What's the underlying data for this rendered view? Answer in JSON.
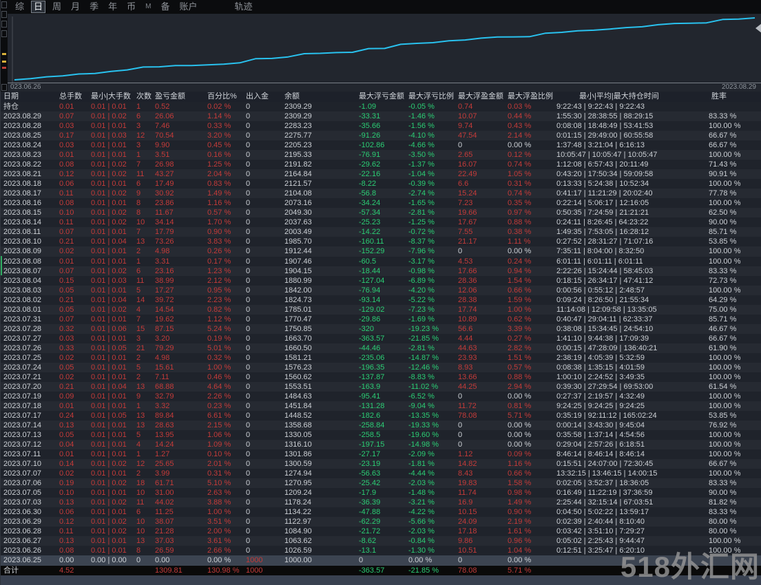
{
  "toolbar": {
    "items": [
      "综",
      "日",
      "周",
      "月",
      "季",
      "年",
      "币",
      "M",
      "备",
      "账户"
    ],
    "active": "日",
    "trail": "轨迹"
  },
  "chart": {
    "start_label": "023.06.26",
    "end_label": "2023.08.29",
    "line_color": "#29c2ef"
  },
  "chart_data": {
    "type": "line",
    "title": "账户余额轨迹",
    "x_start": "2023.06.26",
    "x_end": "2023.08.29",
    "ylim": [
      1000,
      2309.29
    ],
    "values": [
      1000.0,
      1026.59,
      1063.62,
      1084.9,
      1122.97,
      1134.22,
      1178.24,
      1209.24,
      1270.95,
      1274.94,
      1300.59,
      1301.86,
      1316.1,
      1330.05,
      1358.68,
      1448.52,
      1451.84,
      1484.63,
      1553.51,
      1560.62,
      1576.23,
      1581.21,
      1660.5,
      1663.7,
      1750.85,
      1770.47,
      1785.01,
      1824.73,
      1842.0,
      1880.99,
      1904.15,
      1907.46,
      1912.44,
      1985.7,
      2003.49,
      2037.63,
      2049.3,
      2073.16,
      2104.08,
      2121.57,
      2164.84,
      2191.82,
      2195.33,
      2205.23,
      2275.77,
      2283.23,
      2309.29
    ]
  },
  "table": {
    "headers": [
      "日期",
      "总手数",
      "最小|大手数",
      "次数",
      "盈亏金额",
      "百分比%",
      "出入金",
      "余额",
      "最大浮亏金额",
      "最大浮亏比例",
      "最大浮盈金额",
      "最大浮盈比例",
      "最小|平均|最大持仓时间",
      "胜率"
    ],
    "selected_index": 47,
    "total_label": "合计",
    "rows": [
      [
        "持仓",
        "0.01",
        "0.01 | 0.01",
        "1",
        "0.52",
        "0.02 %",
        "0",
        "2309.29",
        "-1.09",
        "-0.05 %",
        "0.74",
        "0.03 %",
        "9:22:43 | 9:22:43 | 9:22:43",
        ""
      ],
      [
        "2023.08.29",
        "0.07",
        "0.01 | 0.02",
        "6",
        "26.06",
        "1.14 %",
        "0",
        "2309.29",
        "-33.31",
        "-1.46 %",
        "10.07",
        "0.44 %",
        "1:55:30 | 28:38:55 | 88:29:15",
        "83.33 %"
      ],
      [
        "2023.08.28",
        "0.03",
        "0.01 | 0.01",
        "3",
        "7.46",
        "0.33 %",
        "0",
        "2283.23",
        "-35.66",
        "-1.56 %",
        "9.74",
        "0.43 %",
        "0:08:08 | 18:48:49 | 53:41:53",
        "100.00 %"
      ],
      [
        "2023.08.25",
        "0.17",
        "0.01 | 0.03",
        "12",
        "70.54",
        "3.20 %",
        "0",
        "2275.77",
        "-91.26",
        "-4.10 %",
        "47.54",
        "2.14 %",
        "0:01:15 | 29:49:00 | 60:55:58",
        "66.67 %"
      ],
      [
        "2023.08.24",
        "0.03",
        "0.01 | 0.01",
        "3",
        "9.90",
        "0.45 %",
        "0",
        "2205.23",
        "-102.86",
        "-4.66 %",
        "0",
        "0.00 %",
        "1:37:48 | 3:21:04 | 6:16:13",
        "66.67 %"
      ],
      [
        "2023.08.23",
        "0.01",
        "0.01 | 0.01",
        "1",
        "3.51",
        "0.16 %",
        "0",
        "2195.33",
        "-76.91",
        "-3.50 %",
        "2.65",
        "0.12 %",
        "10:05:47 | 10:05:47 | 10:05:47",
        "100.00 %"
      ],
      [
        "2023.08.22",
        "0.08",
        "0.01 | 0.02",
        "7",
        "26.98",
        "1.25 %",
        "0",
        "2191.82",
        "-29.62",
        "-1.37 %",
        "16.07",
        "0.74 %",
        "1:12:08 | 6:57:43 | 20:11:49",
        "71.43 %"
      ],
      [
        "2023.08.21",
        "0.12",
        "0.01 | 0.02",
        "11",
        "43.27",
        "2.04 %",
        "0",
        "2164.84",
        "-22.16",
        "-1.04 %",
        "22.49",
        "1.05 %",
        "0:43:20 | 17:50:34 | 59:09:58",
        "90.91 %"
      ],
      [
        "2023.08.18",
        "0.06",
        "0.01 | 0.01",
        "6",
        "17.49",
        "0.83 %",
        "0",
        "2121.57",
        "-8.22",
        "-0.39 %",
        "6.6",
        "0.31 %",
        "0:13:33 | 5:24:38 | 10:52:34",
        "100.00 %"
      ],
      [
        "2023.08.17",
        "0.11",
        "0.01 | 0.02",
        "9",
        "30.92",
        "1.49 %",
        "0",
        "2104.08",
        "-56.8",
        "-2.74 %",
        "15.24",
        "0.74 %",
        "0:41:17 | 11:21:29 | 20:02:40",
        "77.78 %"
      ],
      [
        "2023.08.16",
        "0.08",
        "0.01 | 0.01",
        "8",
        "23.86",
        "1.16 %",
        "0",
        "2073.16",
        "-34.24",
        "-1.65 %",
        "7.23",
        "0.35 %",
        "0:22:14 | 5:06:17 | 12:16:05",
        "100.00 %"
      ],
      [
        "2023.08.15",
        "0.10",
        "0.01 | 0.02",
        "8",
        "11.67",
        "0.57 %",
        "0",
        "2049.30",
        "-57.34",
        "-2.81 %",
        "19.66",
        "0.97 %",
        "0:50:35 | 7:24:59 | 21:21:21",
        "62.50 %"
      ],
      [
        "2023.08.14",
        "0.11",
        "0.01 | 0.02",
        "10",
        "34.14",
        "1.70 %",
        "0",
        "2037.63",
        "-25.23",
        "-1.25 %",
        "17.67",
        "0.88 %",
        "0:24:11 | 8:26:45 | 64:23:22",
        "90.00 %"
      ],
      [
        "2023.08.11",
        "0.07",
        "0.01 | 0.01",
        "7",
        "17.79",
        "0.90 %",
        "0",
        "2003.49",
        "-14.22",
        "-0.72 %",
        "7.55",
        "0.38 %",
        "1:49:35 | 7:53:05 | 16:28:12",
        "85.71 %"
      ],
      [
        "2023.08.10",
        "0.21",
        "0.01 | 0.04",
        "13",
        "73.26",
        "3.83 %",
        "0",
        "1985.70",
        "-160.11",
        "-8.37 %",
        "21.17",
        "1.11 %",
        "0:27:52 | 28:31:27 | 71:07:16",
        "53.85 %"
      ],
      [
        "2023.08.09",
        "0.02",
        "0.01 | 0.01",
        "2",
        "4.98",
        "0.26 %",
        "0",
        "1912.44",
        "-152.29",
        "-7.96 %",
        "0",
        "0.00 %",
        "7:35:11 | 8:04:00 | 8:32:50",
        "100.00 %"
      ],
      [
        "2023.08.08",
        "0.01",
        "0.01 | 0.01",
        "1",
        "3.31",
        "0.17 %",
        "0",
        "1907.46",
        "-60.5",
        "-3.17 %",
        "4.53",
        "0.24 %",
        "6:01:11 | 6:01:11 | 6:01:11",
        "100.00 %"
      ],
      [
        "2023.08.07",
        "0.07",
        "0.01 | 0.02",
        "6",
        "23.16",
        "1.23 %",
        "0",
        "1904.15",
        "-18.44",
        "-0.98 %",
        "17.66",
        "0.94 %",
        "2:22:26 | 15:24:44 | 58:45:03",
        "83.33 %"
      ],
      [
        "2023.08.04",
        "0.15",
        "0.01 | 0.03",
        "11",
        "38.99",
        "2.12 %",
        "0",
        "1880.99",
        "-127.04",
        "-6.89 %",
        "28.36",
        "1.54 %",
        "0:18:15 | 26:34:17 | 47:41:12",
        "72.73 %"
      ],
      [
        "2023.08.03",
        "0.05",
        "0.01 | 0.01",
        "5",
        "17.27",
        "0.95 %",
        "0",
        "1842.00",
        "-76.94",
        "-4.20 %",
        "12.06",
        "0.66 %",
        "0:00:56 | 0:55:12 | 2:48:57",
        "100.00 %"
      ],
      [
        "2023.08.02",
        "0.21",
        "0.01 | 0.04",
        "14",
        "39.72",
        "2.23 %",
        "0",
        "1824.73",
        "-93.14",
        "-5.22 %",
        "28.38",
        "1.59 %",
        "0:09:24 | 8:26:50 | 21:55:34",
        "64.29 %"
      ],
      [
        "2023.08.01",
        "0.05",
        "0.01 | 0.02",
        "4",
        "14.54",
        "0.82 %",
        "0",
        "1785.01",
        "-129.02",
        "-7.23 %",
        "17.74",
        "1.00 %",
        "11:14:08 | 12:09:58 | 13:35:05",
        "75.00 %"
      ],
      [
        "2023.07.31",
        "0.07",
        "0.01 | 0.01",
        "7",
        "19.62",
        "1.12 %",
        "0",
        "1770.47",
        "-29.86",
        "-1.69 %",
        "10.89",
        "0.62 %",
        "0:40:47 | 29:04:11 | 62:33:37",
        "85.71 %"
      ],
      [
        "2023.07.28",
        "0.32",
        "0.01 | 0.06",
        "15",
        "87.15",
        "5.24 %",
        "0",
        "1750.85",
        "-320",
        "-19.23 %",
        "56.6",
        "3.39 %",
        "0:38:08 | 15:34:45 | 24:54:10",
        "46.67 %"
      ],
      [
        "2023.07.27",
        "0.03",
        "0.01 | 0.01",
        "3",
        "3.20",
        "0.19 %",
        "0",
        "1663.70",
        "-363.57",
        "-21.85 %",
        "4.44",
        "0.27 %",
        "1:41:10 | 9:44:38 | 17:09:39",
        "66.67 %"
      ],
      [
        "2023.07.26",
        "0.33",
        "0.01 | 0.05",
        "21",
        "79.29",
        "5.01 %",
        "0",
        "1660.50",
        "-44.46",
        "-2.81 %",
        "44.63",
        "2.82 %",
        "0:00:15 | 47:28:09 | 136:40:21",
        "61.90 %"
      ],
      [
        "2023.07.25",
        "0.02",
        "0.01 | 0.01",
        "2",
        "4.98",
        "0.32 %",
        "0",
        "1581.21",
        "-235.06",
        "-14.87 %",
        "23.93",
        "1.51 %",
        "2:38:19 | 4:05:39 | 5:32:59",
        "100.00 %"
      ],
      [
        "2023.07.24",
        "0.05",
        "0.01 | 0.01",
        "5",
        "15.61",
        "1.00 %",
        "0",
        "1576.23",
        "-196.35",
        "-12.46 %",
        "8.93",
        "0.57 %",
        "0:08:38 | 1:35:15 | 4:01:59",
        "100.00 %"
      ],
      [
        "2023.07.21",
        "0.02",
        "0.01 | 0.01",
        "2",
        "7.11",
        "0.46 %",
        "0",
        "1560.62",
        "-137.87",
        "-8.83 %",
        "13.66",
        "0.88 %",
        "1:00:10 | 2:24:52 | 3:49:35",
        "100.00 %"
      ],
      [
        "2023.07.20",
        "0.21",
        "0.01 | 0.04",
        "13",
        "68.88",
        "4.64 %",
        "0",
        "1553.51",
        "-163.9",
        "-11.02 %",
        "44.25",
        "2.94 %",
        "0:39:30 | 27:29:54 | 69:53:00",
        "61.54 %"
      ],
      [
        "2023.07.19",
        "0.09",
        "0.01 | 0.01",
        "9",
        "32.79",
        "2.26 %",
        "0",
        "1484.63",
        "-95.41",
        "-6.52 %",
        "0",
        "0.00 %",
        "0:27:37 | 2:19:57 | 4:32:49",
        "100.00 %"
      ],
      [
        "2023.07.18",
        "0.01",
        "0.01 | 0.01",
        "1",
        "3.32",
        "0.23 %",
        "0",
        "1451.84",
        "-131.28",
        "-9.04 %",
        "11.72",
        "0.81 %",
        "9:24:25 | 9:24:25 | 9:24:25",
        "100.00 %"
      ],
      [
        "2023.07.17",
        "0.24",
        "0.01 | 0.05",
        "13",
        "89.84",
        "6.61 %",
        "0",
        "1448.52",
        "-182.6",
        "-13.35 %",
        "78.08",
        "5.71 %",
        "0:35:19 | 92:11:12 | 165:02:24",
        "53.85 %"
      ],
      [
        "2023.07.14",
        "0.13",
        "0.01 | 0.01",
        "13",
        "28.63",
        "2.15 %",
        "0",
        "1358.68",
        "-258.84",
        "-19.33 %",
        "0",
        "0.00 %",
        "0:00:14 | 3:43:30 | 9:45:04",
        "76.92 %"
      ],
      [
        "2023.07.13",
        "0.05",
        "0.01 | 0.01",
        "5",
        "13.95",
        "1.06 %",
        "0",
        "1330.05",
        "-258.5",
        "-19.60 %",
        "0",
        "0.00 %",
        "0:35:58 | 1:37:14 | 4:54:56",
        "100.00 %"
      ],
      [
        "2023.07.12",
        "0.04",
        "0.01 | 0.01",
        "4",
        "14.24",
        "1.09 %",
        "0",
        "1316.10",
        "-197.15",
        "-14.98 %",
        "0",
        "0.00 %",
        "0:29:04 | 2:57:26 | 6:18:51",
        "100.00 %"
      ],
      [
        "2023.07.11",
        "0.01",
        "0.01 | 0.01",
        "1",
        "1.27",
        "0.10 %",
        "0",
        "1301.86",
        "-27.17",
        "-2.09 %",
        "1.12",
        "0.09 %",
        "8:46:14 | 8:46:14 | 8:46:14",
        "100.00 %"
      ],
      [
        "2023.07.10",
        "0.14",
        "0.01 | 0.02",
        "12",
        "25.65",
        "2.01 %",
        "0",
        "1300.59",
        "-23.19",
        "-1.81 %",
        "14.82",
        "1.16 %",
        "0:15:51 | 24:07:00 | 72:30:45",
        "66.67 %"
      ],
      [
        "2023.07.07",
        "0.02",
        "0.01 | 0.01",
        "2",
        "3.99",
        "0.31 %",
        "0",
        "1274.94",
        "-56.63",
        "-4.44 %",
        "8.43",
        "0.66 %",
        "13:32:15 | 13:46:15 | 14:00:15",
        "100.00 %"
      ],
      [
        "2023.07.06",
        "0.19",
        "0.01 | 0.02",
        "18",
        "61.71",
        "5.10 %",
        "0",
        "1270.95",
        "-25.42",
        "-2.03 %",
        "19.83",
        "1.58 %",
        "0:02:05 | 3:52:37 | 18:36:05",
        "83.33 %"
      ],
      [
        "2023.07.05",
        "0.10",
        "0.01 | 0.01",
        "10",
        "31.00",
        "2.63 %",
        "0",
        "1209.24",
        "-17.9",
        "-1.48 %",
        "11.74",
        "0.98 %",
        "0:16:49 | 11:22:19 | 37:36:59",
        "90.00 %"
      ],
      [
        "2023.07.03",
        "0.13",
        "0.01 | 0.02",
        "11",
        "44.02",
        "3.88 %",
        "0",
        "1178.24",
        "-36.39",
        "-3.21 %",
        "16.9",
        "1.49 %",
        "2:25:44 | 32:15:14 | 67:03:51",
        "81.82 %"
      ],
      [
        "2023.06.30",
        "0.06",
        "0.01 | 0.01",
        "6",
        "11.25",
        "1.00 %",
        "0",
        "1134.22",
        "-47.88",
        "-4.22 %",
        "10.15",
        "0.90 %",
        "0:04:50 | 5:02:22 | 13:59:17",
        "83.33 %"
      ],
      [
        "2023.06.29",
        "0.12",
        "0.01 | 0.02",
        "10",
        "38.07",
        "3.51 %",
        "0",
        "1122.97",
        "-62.29",
        "-5.66 %",
        "24.09",
        "2.19 %",
        "0:02:39 | 2:40:44 | 8:10:40",
        "80.00 %"
      ],
      [
        "2023.06.28",
        "0.11",
        "0.01 | 0.02",
        "10",
        "21.28",
        "2.00 %",
        "0",
        "1084.90",
        "-21.72",
        "-2.03 %",
        "17.18",
        "1.61 %",
        "0:03:42 | 3:51:10 | 7:29:27",
        "80.00 %"
      ],
      [
        "2023.06.27",
        "0.13",
        "0.01 | 0.01",
        "13",
        "37.03",
        "3.61 %",
        "0",
        "1063.62",
        "-8.62",
        "-0.84 %",
        "9.86",
        "0.96 %",
        "0:05:02 | 2:25:43 | 9:44:47",
        "100.00 %"
      ],
      [
        "2023.06.26",
        "0.08",
        "0.01 | 0.01",
        "8",
        "26.59",
        "2.66 %",
        "0",
        "1026.59",
        "-13.1",
        "-1.30 %",
        "10.51",
        "1.04 %",
        "0:12:51 | 3:25:47 | 6:20:10",
        "100.00 %"
      ],
      [
        "2023.06.25",
        "0.00",
        "0.00 | 0.00",
        "0",
        "0.00",
        "0.00 %",
        "1000",
        "1000.00",
        "0",
        "0.00 %",
        "0",
        "0.00 %",
        "",
        ""
      ],
      [
        "合计",
        "4.52",
        "",
        "",
        "1309.81",
        "130.98 %",
        "1000",
        "",
        "-363.57",
        "-21.85 %",
        "78.08",
        "5.71 %",
        "",
        ""
      ]
    ]
  },
  "watermark": "518外汇网",
  "colors": {
    "positive_red": "#c43b39",
    "negative_green": "#2bce74",
    "chart_line": "#29c2ef",
    "selected_row_bg": "#3c4451",
    "total_row_bg": "#0a0a0a"
  }
}
